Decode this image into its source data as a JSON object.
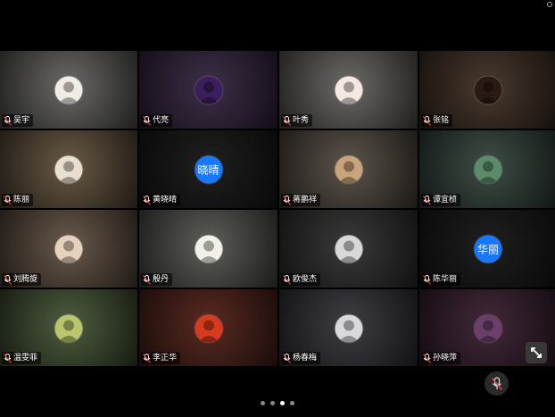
{
  "participants": [
    {
      "name": "吴宇",
      "avatar_text": "",
      "bg": "#6b6a68",
      "avatar_bg": "#f1ede6",
      "avatar_icon": "man-in-suit-photo"
    },
    {
      "name": "代亮",
      "avatar_text": "",
      "bg": "#3f2f4a",
      "avatar_bg": "#3a1f5c",
      "avatar_icon": "person-photo"
    },
    {
      "name": "叶秀",
      "avatar_text": "",
      "bg": "#6d6b68",
      "avatar_bg": "#f3e8e2",
      "avatar_icon": "woman-photo"
    },
    {
      "name": "张铭",
      "avatar_text": "",
      "bg": "#4a3a2e",
      "avatar_bg": "#2a1a12",
      "avatar_icon": "calligraphy-logo"
    },
    {
      "name": "陈丽",
      "avatar_text": "",
      "bg": "#6a5a46",
      "avatar_bg": "#eadfcf",
      "avatar_icon": "sailboat-drawing"
    },
    {
      "name": "黄晓晴",
      "avatar_text": "晓晴",
      "bg": "#1f1f1f",
      "avatar_bg": "#1677ff",
      "avatar_icon": ""
    },
    {
      "name": "蒋鹏祥",
      "avatar_text": "",
      "bg": "#5d554c",
      "avatar_bg": "#c9a37a",
      "avatar_icon": "wood-texture"
    },
    {
      "name": "谭宜桢",
      "avatar_text": "",
      "bg": "#3f4e47",
      "avatar_bg": "#5b8b6a",
      "avatar_icon": "outdoor-person-photo"
    },
    {
      "name": "刘腾旋",
      "avatar_text": "",
      "bg": "#6a5a4c",
      "avatar_bg": "#e6d2bc",
      "avatar_icon": "hamster-photo"
    },
    {
      "name": "殷丹",
      "avatar_text": "",
      "bg": "#5e5e5a",
      "avatar_bg": "#f1f1ea",
      "avatar_icon": "text-logo"
    },
    {
      "name": "欧俊杰",
      "avatar_text": "",
      "bg": "#3a3a3a",
      "avatar_bg": "#d8d8d8",
      "avatar_icon": "man-in-suit-photo"
    },
    {
      "name": "陈华丽",
      "avatar_text": "华丽",
      "bg": "#1f1f1f",
      "avatar_bg": "#1677ff",
      "avatar_icon": ""
    },
    {
      "name": "温雯菲",
      "avatar_text": "",
      "bg": "#4f5d3f",
      "avatar_bg": "#b9c66b",
      "avatar_icon": "flower-field-photo"
    },
    {
      "name": "李正华",
      "avatar_text": "",
      "bg": "#5a2a22",
      "avatar_bg": "#d83a1e",
      "avatar_icon": "red-flowers-photo"
    },
    {
      "name": "杨春梅",
      "avatar_text": "",
      "bg": "#3f3f44",
      "avatar_bg": "#d9d9dd",
      "avatar_icon": "woman-in-suit-photo"
    },
    {
      "name": "孙晓萍",
      "avatar_text": "",
      "bg": "#43293a",
      "avatar_bg": "#6a3f6a",
      "avatar_icon": "sunset-photo"
    }
  ],
  "controls": {
    "expand_icon": "expand-arrow-icon",
    "mic_icon": "microphone-muted-icon"
  },
  "pager": {
    "count": 4,
    "active_index": 2
  }
}
